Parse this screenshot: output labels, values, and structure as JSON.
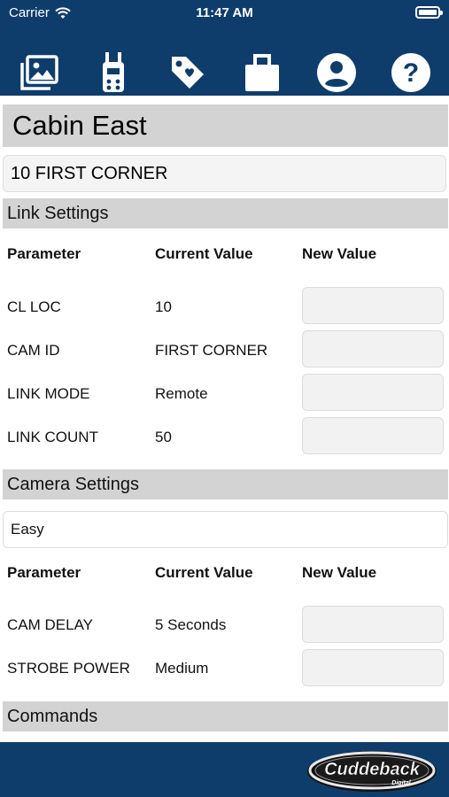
{
  "status_bar": {
    "carrier": "Carrier",
    "time": "11:47 AM"
  },
  "toolbar": {
    "icons": [
      "photos-icon",
      "device-remote-icon",
      "tag-icon",
      "suitcase-icon",
      "account-icon",
      "help-icon"
    ]
  },
  "header": {
    "title": "Cabin East",
    "camera_name": "10 FIRST CORNER"
  },
  "link_settings": {
    "section_label": "Link Settings",
    "col_parameter": "Parameter",
    "col_current": "Current Value",
    "col_new": "New Value",
    "rows": [
      {
        "parameter": "CL LOC",
        "current": "10",
        "new_value": ""
      },
      {
        "parameter": "CAM ID",
        "current": "FIRST CORNER",
        "new_value": ""
      },
      {
        "parameter": "LINK MODE",
        "current": "Remote",
        "new_value": ""
      },
      {
        "parameter": "LINK COUNT",
        "current": "50",
        "new_value": ""
      }
    ]
  },
  "camera_settings": {
    "section_label": "Camera Settings",
    "mode": "Easy",
    "col_parameter": "Parameter",
    "col_current": "Current Value",
    "col_new": "New Value",
    "rows": [
      {
        "parameter": "CAM DELAY",
        "current": "5 Seconds",
        "new_value": ""
      },
      {
        "parameter": "STROBE POWER",
        "current": "Medium",
        "new_value": ""
      }
    ]
  },
  "commands": {
    "section_label": "Commands"
  },
  "brand": {
    "logo_text": "Cuddeback",
    "logo_subtext": "Digital"
  },
  "colors": {
    "bar_blue": "#0f3d6b",
    "section_gray": "#d3d3d3",
    "icon_white": "#ffffff"
  }
}
